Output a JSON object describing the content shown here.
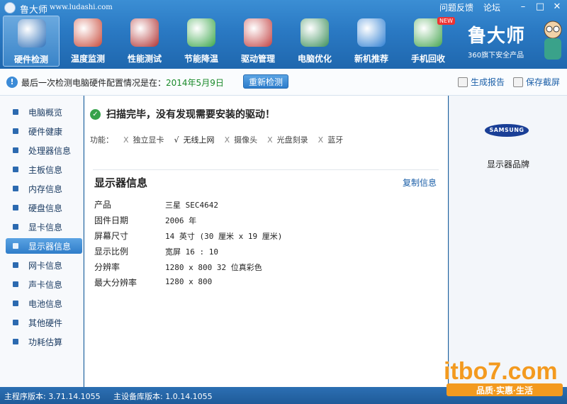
{
  "window": {
    "app_name": "鲁大师",
    "url": "www.ludashi.com",
    "links": [
      "问题反馈",
      "论坛"
    ],
    "controls": [
      "–",
      "□",
      "✕"
    ]
  },
  "toolbar": {
    "tabs": [
      {
        "label": "硬件检测",
        "icon": "hardware-check-icon",
        "color": "#2d6fb8",
        "active": true
      },
      {
        "label": "温度监测",
        "icon": "thermometer-icon",
        "color": "#c84a3a"
      },
      {
        "label": "性能测试",
        "icon": "speedometer-icon",
        "color": "#b03232"
      },
      {
        "label": "节能降温",
        "icon": "clover-icon",
        "color": "#3aa64a"
      },
      {
        "label": "驱动管理",
        "icon": "driver-chip-icon",
        "color": "#c24141"
      },
      {
        "label": "电脑优化",
        "icon": "optimize-screen-icon",
        "color": "#3c8f5a"
      },
      {
        "label": "新机推荐",
        "icon": "new-pc-icon",
        "color": "#2f7fd2"
      },
      {
        "label": "手机回收",
        "icon": "phone-recycle-icon",
        "color": "#46a550",
        "badge": "NEW"
      }
    ]
  },
  "brand": {
    "name": "鲁大师",
    "tagline": "360旗下安全产品"
  },
  "infobar": {
    "text": "最后一次检测电脑硬件配置情况是在：",
    "date": "2014年5月9日",
    "recheck_label": "重新检测",
    "report_label": "生成报告",
    "screenshot_label": "保存截屏"
  },
  "sidebar": {
    "items": [
      {
        "label": "电脑概览"
      },
      {
        "label": "硬件健康"
      },
      {
        "label": "处理器信息"
      },
      {
        "label": "主板信息"
      },
      {
        "label": "内存信息"
      },
      {
        "label": "硬盘信息"
      },
      {
        "label": "显卡信息"
      },
      {
        "label": "显示器信息",
        "active": true
      },
      {
        "label": "网卡信息"
      },
      {
        "label": "声卡信息"
      },
      {
        "label": "电池信息"
      },
      {
        "label": "其他硬件"
      },
      {
        "label": "功耗估算"
      }
    ]
  },
  "main": {
    "scan_status": "扫描完毕，没有发现需要安装的驱动！",
    "functions_label": "功能：",
    "functions": [
      {
        "mark": "X",
        "label": "独立显卡"
      },
      {
        "mark": "√",
        "label": "无线上网"
      },
      {
        "mark": "X",
        "label": "摄像头"
      },
      {
        "mark": "X",
        "label": "光盘刻录"
      },
      {
        "mark": "X",
        "label": "蓝牙"
      }
    ],
    "section_title": "显示器信息",
    "copy_label": "复制信息",
    "rows": [
      {
        "key": "产品",
        "value": "三星 SEC4642"
      },
      {
        "key": "固件日期",
        "value": "2006 年"
      },
      {
        "key": "屏幕尺寸",
        "value": "14 英寸 (30 厘米 x 19 厘米)"
      },
      {
        "key": "显示比例",
        "value": "宽屏 16 : 10"
      },
      {
        "key": "分辨率",
        "value": "1280 x 800 32 位真彩色"
      },
      {
        "key": "最大分辨率",
        "value": "1280 x 800"
      }
    ]
  },
  "right": {
    "logo_text": "SAMSUNG",
    "caption": "显示器品牌"
  },
  "statusbar": {
    "main_version": "主程序版本: 3.71.14.1055",
    "db_version": "主设备库版本: 1.0.14.1055"
  },
  "watermark": {
    "logo": "itbo7.com",
    "slogan": "品质·实惠·生活"
  }
}
